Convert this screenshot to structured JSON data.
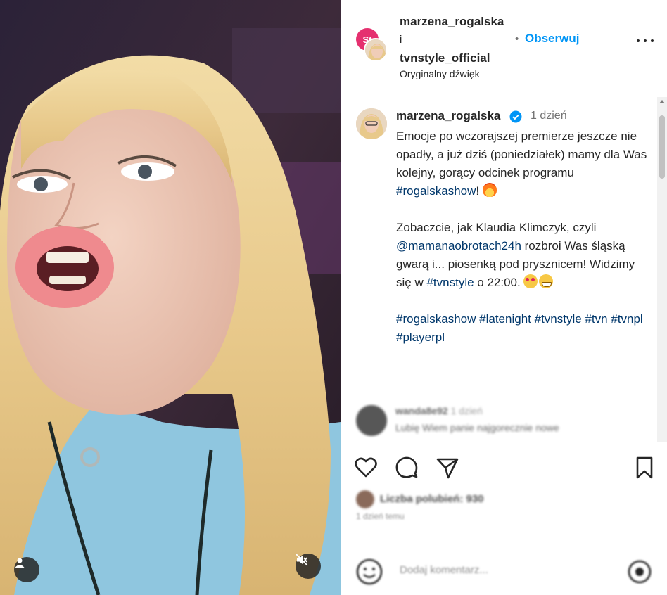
{
  "header": {
    "brand_avatar_text": "St",
    "user1": "marzena_rogalska",
    "conjunction": "i",
    "user2": "tvnstyle_official",
    "audio": "Oryginalny dźwięk",
    "separator": "•",
    "follow_label": "Obserwuj",
    "more_icon": "more-horizontal-icon"
  },
  "caption": {
    "username": "marzena_rogalska",
    "verified_icon": "verified-badge-icon",
    "time": "1 dzień",
    "p1_pre": "Emocje po wczorajszej premierze jeszcze nie opadły, a już dziś (poniedziałek) mamy dla Was kolejny, gorący odcinek programu ",
    "p1_tag": "#rogalskashow",
    "p1_post": "! ",
    "p2_pre": "Zobaczcie, jak Klaudia Klimczyk, czyli ",
    "p2_mention": "@mamanaobrotach24h",
    "p2_mid": " rozbroi Was śląską gwarą i... piosenką pod prysznicem! Widzimy się w ",
    "p2_tag": "#tvnstyle",
    "p2_post": " o 22:00. ",
    "hashtags": [
      "#rogalskashow",
      "#latenight",
      "#tvnstyle",
      "#tvn",
      "#tvnpl",
      "#playerpl"
    ]
  },
  "comment": {
    "username": "wanda8e92",
    "time": "1 dzień",
    "text": "Lubię Wiem panie najgorecznie nowe"
  },
  "actions": {
    "like_icon": "heart-icon",
    "comment_icon": "comment-icon",
    "share_icon": "send-icon",
    "save_icon": "bookmark-icon",
    "likes_text": "Liczba polubień: 930",
    "ago": "1 dzień temu"
  },
  "add_comment": {
    "emoji_icon": "emoji-icon",
    "placeholder": "Dodaj komentarz...",
    "gif_icon": "gif-icon"
  },
  "media": {
    "user_tag_icon": "user-tag-icon",
    "mute_icon": "muted-speaker-icon"
  },
  "colors": {
    "link": "#0095f6",
    "hashtag": "#00376b",
    "brand_avatar": "#e5306f",
    "shirt": "#8fc6df"
  }
}
